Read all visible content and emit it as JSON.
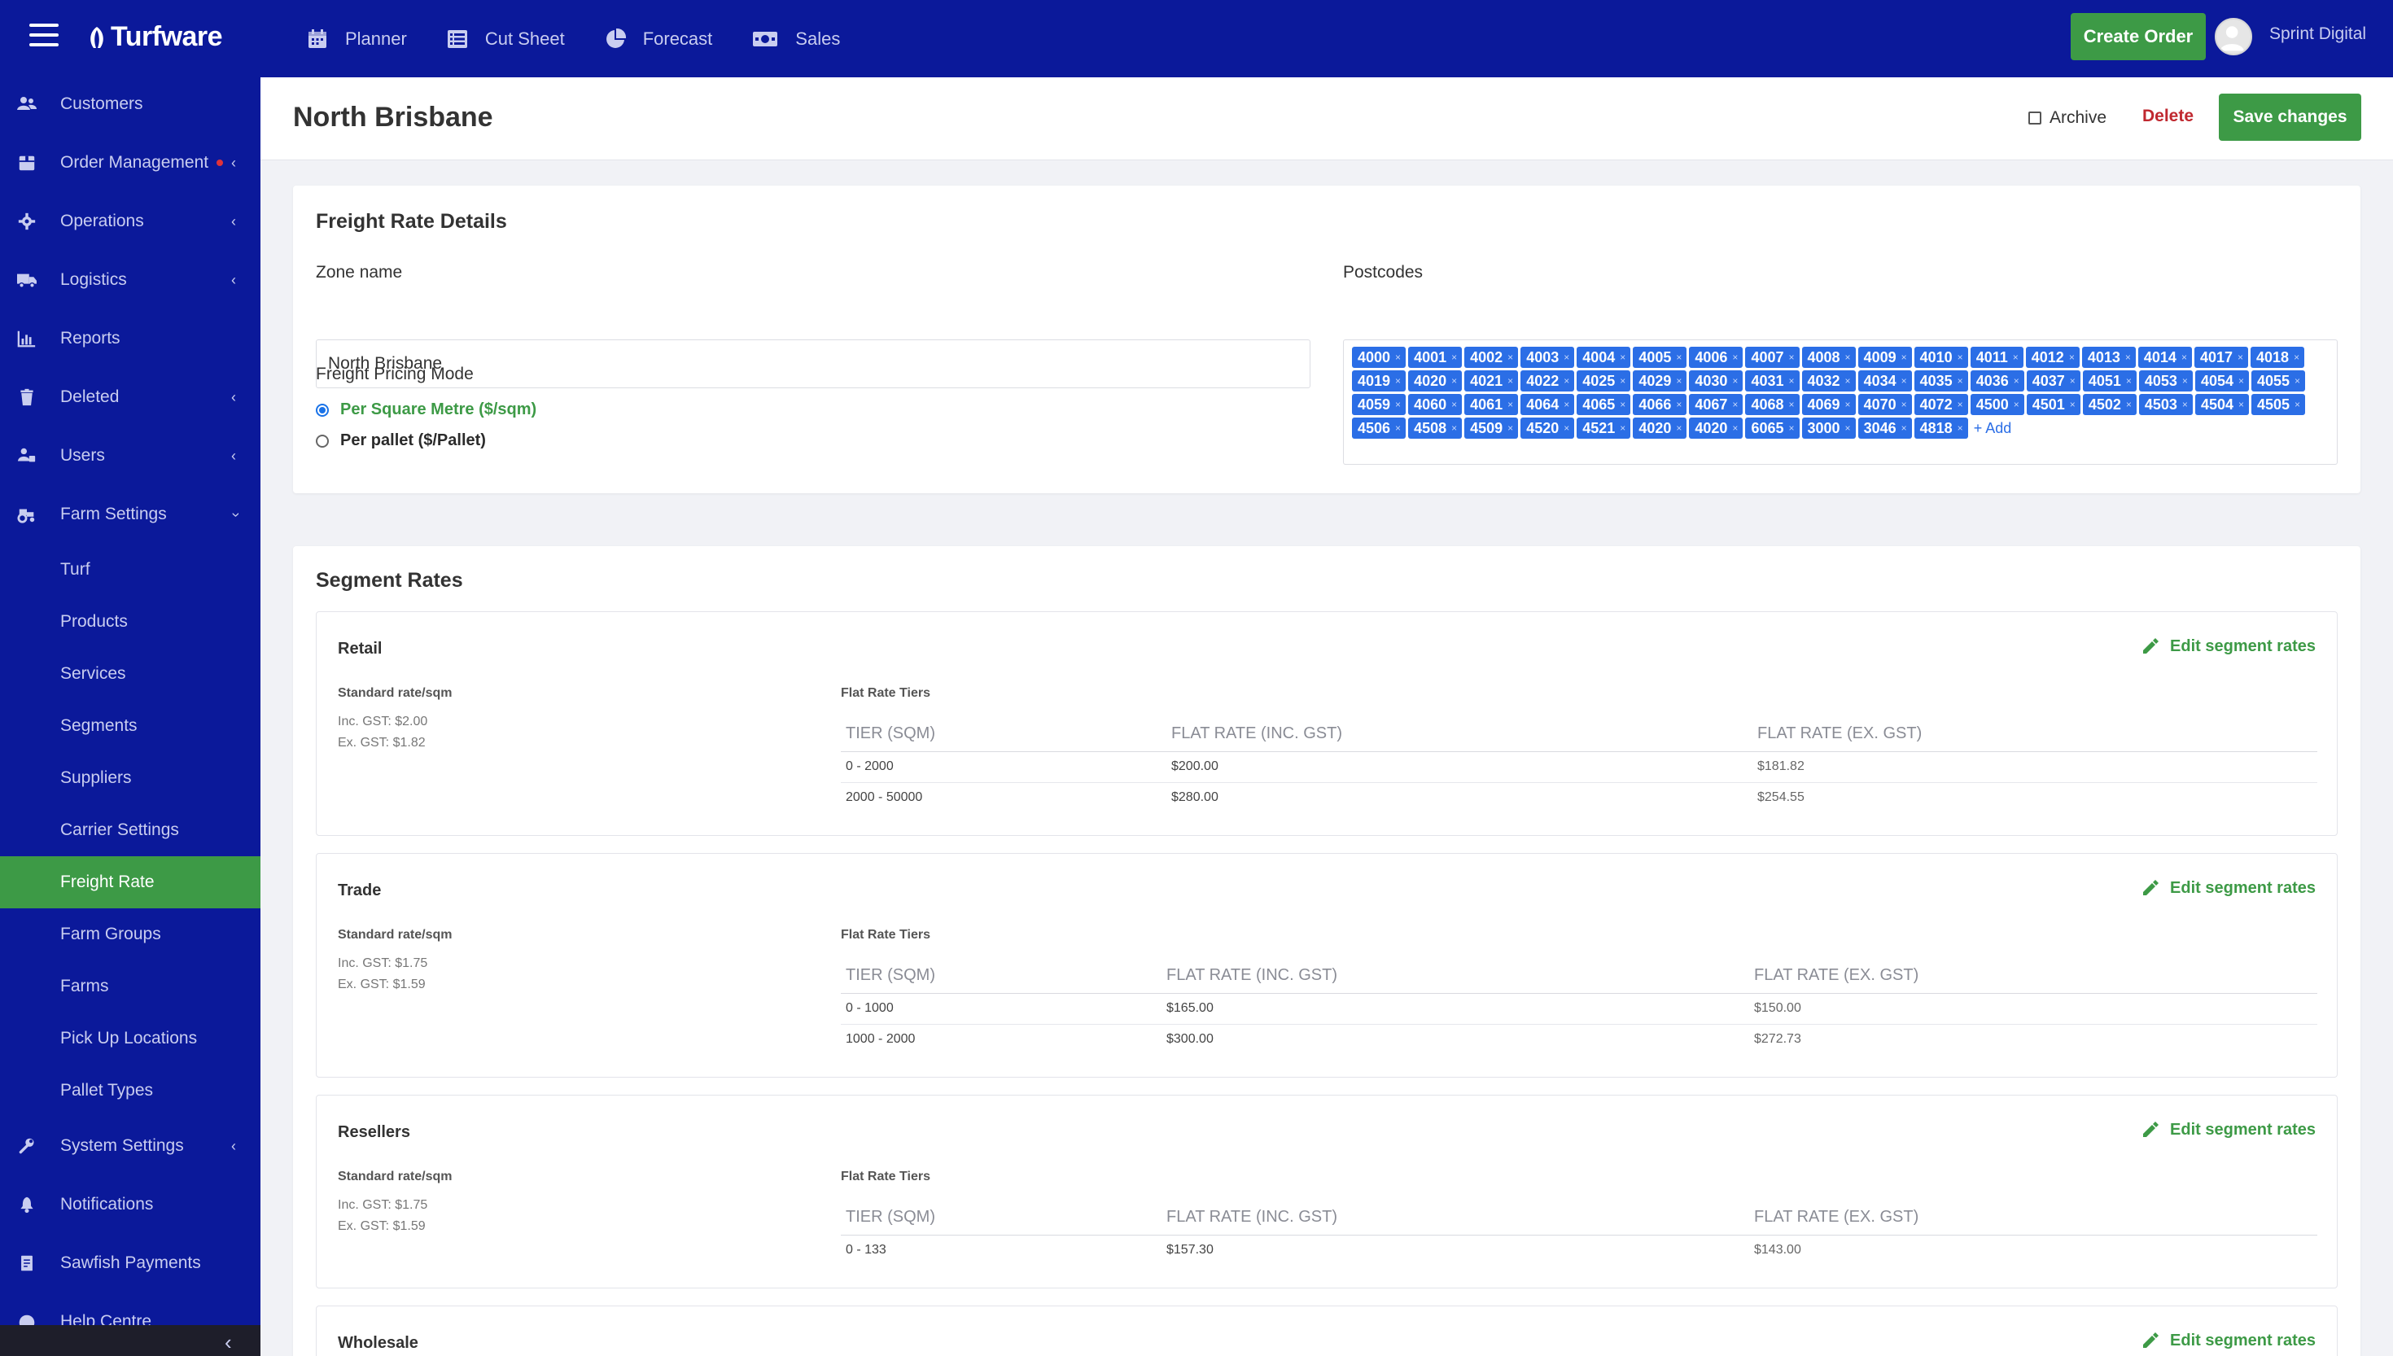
{
  "app": {
    "brand": "Turfware",
    "nav": [
      {
        "label": "Planner",
        "icon": "calendar-icon"
      },
      {
        "label": "Cut Sheet",
        "icon": "list-icon"
      },
      {
        "label": "Forecast",
        "icon": "pie-chart-icon"
      },
      {
        "label": "Sales",
        "icon": "money-icon"
      }
    ],
    "create_order": "Create Order",
    "user_name": "Sprint Digital"
  },
  "sidebar": {
    "items": [
      {
        "label": "Customers",
        "icon": "users-icon",
        "chevron": false
      },
      {
        "label": "Order Management",
        "icon": "box-icon",
        "chevron": true,
        "dot": true
      },
      {
        "label": "Operations",
        "icon": "gear-icon",
        "chevron": true
      },
      {
        "label": "Logistics",
        "icon": "truck-icon",
        "chevron": true
      },
      {
        "label": "Reports",
        "icon": "bar-chart-icon",
        "chevron": false
      },
      {
        "label": "Deleted",
        "icon": "trash-icon",
        "chevron": true
      },
      {
        "label": "Users",
        "icon": "user-group-icon",
        "chevron": true
      },
      {
        "label": "Farm Settings",
        "icon": "tractor-icon",
        "chevron": true,
        "expanded": true
      }
    ],
    "farm_settings_children": [
      "Turf",
      "Products",
      "Services",
      "Segments",
      "Suppliers",
      "Carrier Settings",
      "Freight Rate",
      "Farm Groups",
      "Farms",
      "Pick Up Locations",
      "Pallet Types"
    ],
    "active_child": "Freight Rate",
    "bottom_items": [
      {
        "label": "System Settings",
        "icon": "wrench-icon",
        "chevron": true
      },
      {
        "label": "Notifications",
        "icon": "bell-icon",
        "chevron": false
      },
      {
        "label": "Sawfish Payments",
        "icon": "invoice-icon",
        "chevron": false
      },
      {
        "label": "Help Centre",
        "icon": "help-icon",
        "chevron": false
      }
    ]
  },
  "page": {
    "title": "North Brisbane",
    "archive_label": "Archive",
    "delete_label": "Delete",
    "save_label": "Save changes"
  },
  "freight_details": {
    "heading": "Freight Rate Details",
    "zone_label": "Zone name",
    "zone_value": "North Brisbane",
    "mode_label": "Freight Pricing Mode",
    "mode_options": [
      "Per Square Metre ($/sqm)",
      "Per pallet ($/Pallet)"
    ],
    "mode_selected": 0,
    "postcodes_label": "Postcodes",
    "postcodes": [
      "4000",
      "4001",
      "4002",
      "4003",
      "4004",
      "4005",
      "4006",
      "4007",
      "4008",
      "4009",
      "4010",
      "4011",
      "4012",
      "4013",
      "4014",
      "4017",
      "4018",
      "4019",
      "4020",
      "4021",
      "4022",
      "4025",
      "4029",
      "4030",
      "4031",
      "4032",
      "4034",
      "4035",
      "4036",
      "4037",
      "4051",
      "4053",
      "4054",
      "4055",
      "4059",
      "4060",
      "4061",
      "4064",
      "4065",
      "4066",
      "4067",
      "4068",
      "4069",
      "4070",
      "4072",
      "4500",
      "4501",
      "4502",
      "4503",
      "4504",
      "4505",
      "4506",
      "4508",
      "4509",
      "4520",
      "4521",
      "4020",
      "4020",
      "6065",
      "3000",
      "3046",
      "4818"
    ],
    "add_label": "+ Add"
  },
  "segment_rates": {
    "heading": "Segment Rates",
    "edit_label": "Edit segment rates",
    "std_title": "Standard rate/sqm",
    "tiers_title": "Flat Rate Tiers",
    "columns": [
      "TIER (SQM)",
      "FLAT RATE (INC. GST)",
      "FLAT RATE (EX. GST)"
    ],
    "segments": [
      {
        "name": "Retail",
        "inc": "Inc. GST: $2.00",
        "ex": "Ex. GST: $1.82",
        "tiers": [
          [
            "0 - 2000",
            "$200.00",
            "$181.82"
          ],
          [
            "2000 - 50000",
            "$280.00",
            "$254.55"
          ]
        ]
      },
      {
        "name": "Trade",
        "inc": "Inc. GST: $1.75",
        "ex": "Ex. GST: $1.59",
        "tiers": [
          [
            "0 - 1000",
            "$165.00",
            "$150.00"
          ],
          [
            "1000 - 2000",
            "$300.00",
            "$272.73"
          ]
        ]
      },
      {
        "name": "Resellers",
        "inc": "Inc. GST: $1.75",
        "ex": "Ex. GST: $1.59",
        "tiers": [
          [
            "0 - 133",
            "$157.30",
            "$143.00"
          ]
        ]
      },
      {
        "name": "Wholesale"
      }
    ]
  },
  "colors": {
    "nav_bg": "#0b199a",
    "accent_green": "#3d9a46",
    "tag_blue": "#2b6ee6",
    "danger": "#c0282f"
  }
}
